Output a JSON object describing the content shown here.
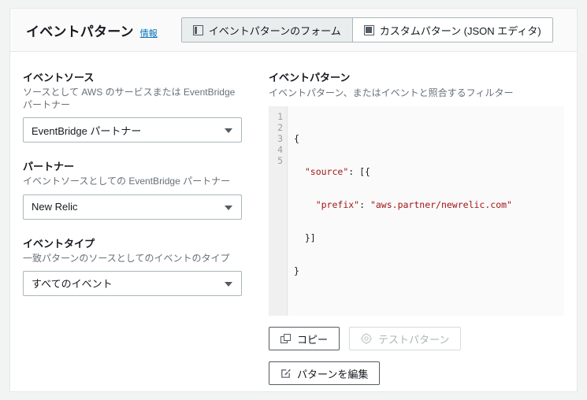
{
  "header": {
    "title": "イベントパターン",
    "info_link": "情報",
    "tabs": [
      {
        "label": "イベントパターンのフォーム",
        "icon": "panel-left-icon",
        "selected": true
      },
      {
        "label": "カスタムパターン (JSON エディタ)",
        "icon": "panel-filled-icon",
        "selected": false
      }
    ]
  },
  "form": {
    "fields": [
      {
        "label": "イベントソース",
        "description": "ソースとして AWS のサービスまたは EventBridge パートナー",
        "value": "EventBridge パートナー"
      },
      {
        "label": "パートナー",
        "description": "イベントソースとしての EventBridge パートナー",
        "value": "New Relic"
      },
      {
        "label": "イベントタイプ",
        "description": "一致パターンのソースとしてのイベントのタイプ",
        "value": "すべてのイベント"
      }
    ]
  },
  "pattern": {
    "label": "イベントパターン",
    "description": "イベントパターン、またはイベントと照合するフィルター",
    "line_numbers": [
      "1",
      "2",
      "3",
      "4",
      "5"
    ],
    "code_lines": [
      "{",
      "  \"source\": [{",
      "    \"prefix\": \"aws.partner/newrelic.com\"",
      "  }]",
      "}"
    ],
    "code_text": "{\n  \"source\": [{\n    \"prefix\": \"aws.partner/newrelic.com\"\n  }]\n}",
    "buttons": {
      "copy": "コピー",
      "test_pattern": "テストパターン",
      "edit_pattern": "パターンを編集"
    }
  },
  "colors": {
    "link": "#0073bb",
    "string_token": "#a31515",
    "page_background": "#f2f3f3",
    "panel_background": "#ffffff",
    "editor_background": "#fafafa",
    "gutter_background": "#f0f0f0"
  }
}
